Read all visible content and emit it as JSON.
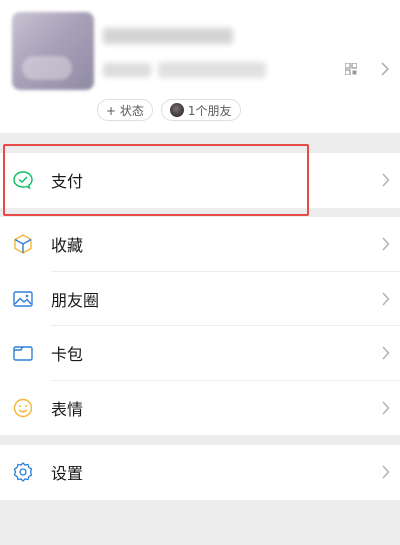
{
  "profile": {
    "status_chip": {
      "icon": "plus-icon",
      "label": "+ 状态"
    },
    "friends_chip": {
      "icon": "avatar",
      "label": "1个朋友"
    },
    "qr_icon": "qrcode-icon",
    "chevron_icon": "chevron-right-icon"
  },
  "menu": {
    "pay": {
      "label": "支付",
      "icon": "pay-icon"
    },
    "favorites": {
      "label": "收藏",
      "icon": "favorites-icon"
    },
    "moments": {
      "label": "朋友圈",
      "icon": "moments-icon"
    },
    "cards": {
      "label": "卡包",
      "icon": "card-wallet-icon"
    },
    "stickers": {
      "label": "表情",
      "icon": "emoji-icon"
    },
    "settings": {
      "label": "设置",
      "icon": "gear-icon"
    }
  },
  "colors": {
    "accent_green": "#07c160",
    "highlight_red": "#e84a4a",
    "icon_blue": "#2e7fd8",
    "icon_yellow": "#f5b63a"
  }
}
